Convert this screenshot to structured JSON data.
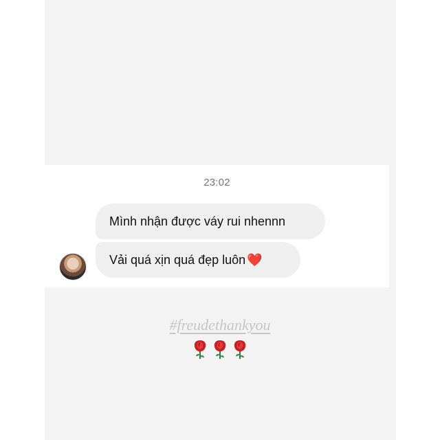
{
  "chat": {
    "timestamp": "23:02",
    "messages": [
      {
        "text": "Mình nhận được váy rui nhennn"
      },
      {
        "text": "Vải quá xịn quá đẹp luôn",
        "emoji": "❤️"
      }
    ],
    "avatar_icon": "user-avatar"
  },
  "caption": {
    "hashtag": "#freudethankyou",
    "emojis": [
      "rose",
      "rose",
      "rose"
    ]
  },
  "colors": {
    "background": "#f3f3f3",
    "card": "#ffffff",
    "bubble": "#efefef",
    "hashtag": "#c5c5c5",
    "heart": "#d9182b",
    "rose": "#c91f24"
  }
}
